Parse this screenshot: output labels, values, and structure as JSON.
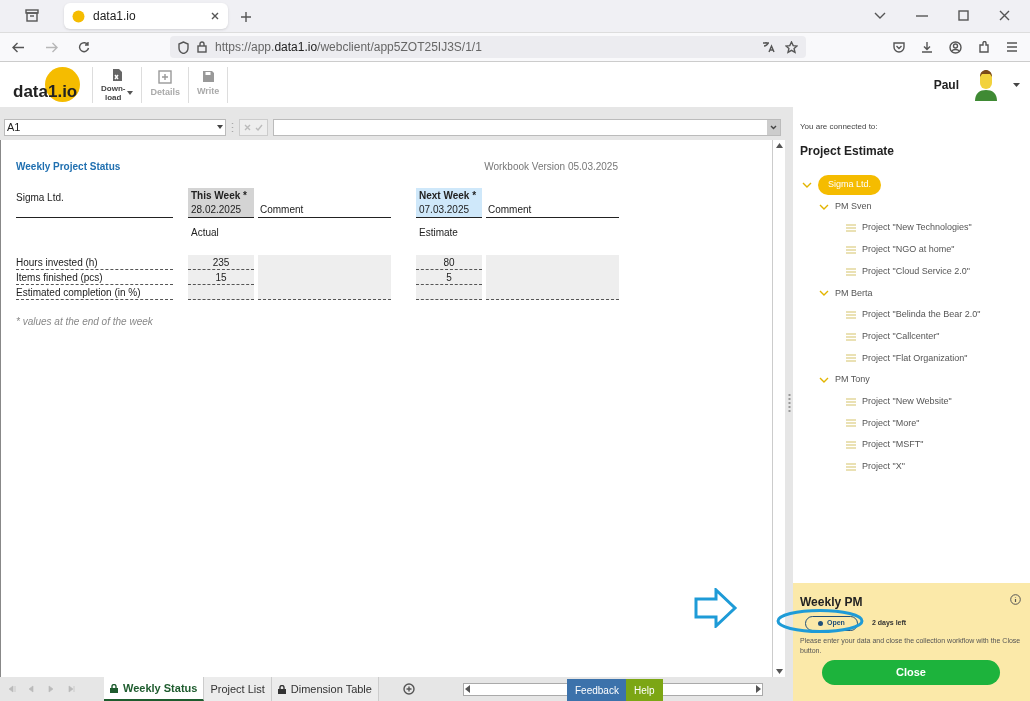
{
  "browser": {
    "tab_title": "data1.io",
    "url": "https://app.**data1.io**/webclient/app5ZOT25IJ3S/1/1"
  },
  "app_header": {
    "logo": "data1.io",
    "tools": [
      {
        "label": "Down-\nload",
        "kind": "dropdown",
        "disabled": false
      },
      {
        "label": "Details",
        "kind": "button",
        "disabled": true
      },
      {
        "label": "Write",
        "kind": "button",
        "disabled": true
      }
    ],
    "user": "Paul"
  },
  "formula_bar": {
    "cell_ref": "A1"
  },
  "sheet": {
    "title": "Weekly Project Status",
    "version": "Workbook Version 05.03.2025",
    "company": "Sigma Ltd.",
    "groups": [
      {
        "header": "This Week *",
        "date": "28.02.2025",
        "comment": "Comment",
        "sub": "Actual",
        "color": "#d4d4d4"
      },
      {
        "header": "Next Week *",
        "date": "07.03.2025",
        "comment": "Comment",
        "sub": "Estimate",
        "color": "#cfe8fa"
      }
    ],
    "rows": [
      {
        "label": "Hours invested (h)",
        "values": [
          "235",
          "80"
        ]
      },
      {
        "label": "Items finished (pcs)",
        "values": [
          "15",
          "5"
        ]
      },
      {
        "label": "Estimated completion (in %)",
        "values": []
      }
    ],
    "footnote": "* values at the end of the week"
  },
  "panel": {
    "connected_label": "You are connected to:",
    "title": "Project Estimate",
    "tree": [
      {
        "label": "Sigma Ltd.",
        "selected": true,
        "expanded": true,
        "children": [
          {
            "label": "PM Sven",
            "selected": false,
            "expanded": true,
            "children": [
              {
                "label": "Project \"New Technologies\"",
                "selected": false
              },
              {
                "label": "Project \"NGO at home\"",
                "selected": false
              },
              {
                "label": "Project \"Cloud Service 2.0\"",
                "selected": false
              }
            ]
          },
          {
            "label": "PM Berta",
            "selected": false,
            "expanded": true,
            "children": [
              {
                "label": "Project \"Belinda the Bear 2.0\"",
                "selected": false
              },
              {
                "label": "Project \"Callcenter\"",
                "selected": false
              },
              {
                "label": "Project \"Flat Organization\"",
                "selected": false
              }
            ]
          },
          {
            "label": "PM Tony",
            "selected": false,
            "expanded": true,
            "children": [
              {
                "label": "Project \"New Website\"",
                "selected": false
              },
              {
                "label": "Project \"More\"",
                "selected": false
              },
              {
                "label": "Project \"MSFT\"",
                "selected": false
              },
              {
                "label": "Project \"X\"",
                "selected": false
              }
            ]
          }
        ]
      }
    ]
  },
  "workflow": {
    "title": "Weekly PM",
    "status": "Open",
    "days_left": "2 days left",
    "message": "Please enter your data and close the collection workflow with the Close button.",
    "button": "Close"
  },
  "sheet_tabs": [
    {
      "label": "Weekly Status",
      "locked": true,
      "selected": true
    },
    {
      "label": "Project List",
      "locked": false,
      "selected": false
    },
    {
      "label": "Dimension Table",
      "locked": true,
      "selected": false
    }
  ],
  "feedback": "Feedback",
  "help": "Help"
}
